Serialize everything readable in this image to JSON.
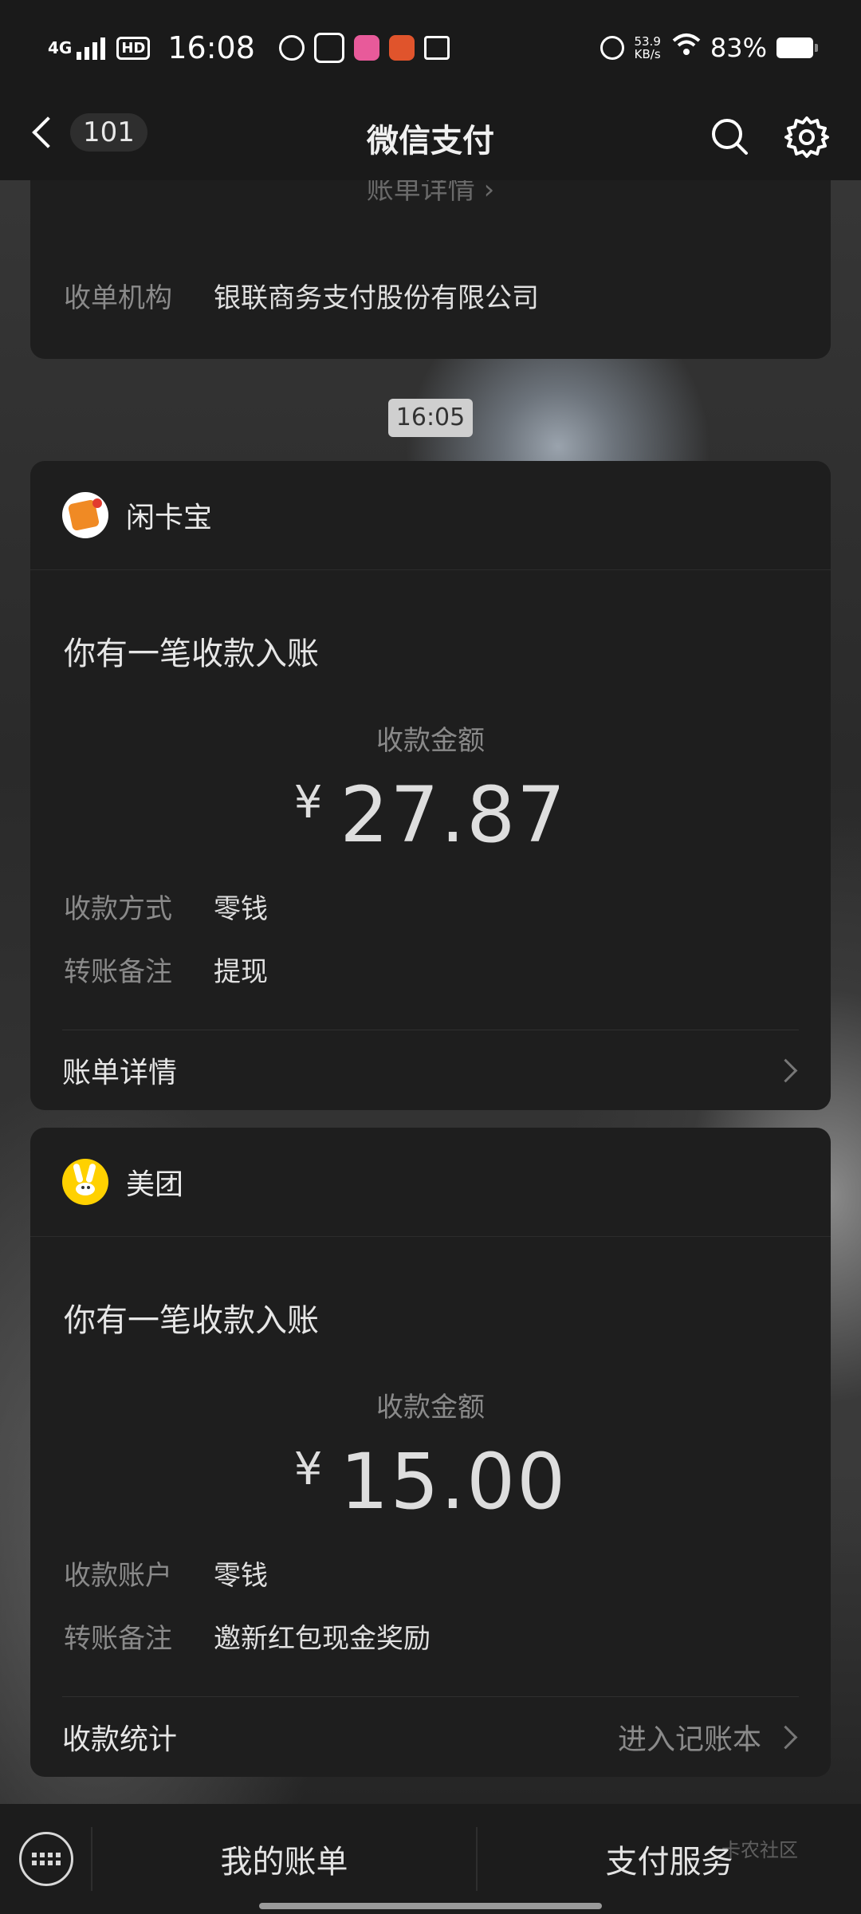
{
  "status_bar": {
    "network": "4G",
    "hd": "HD",
    "time": "16:08",
    "net_speed_value": "53.9",
    "net_speed_unit": "KB/s",
    "battery": "83%"
  },
  "nav": {
    "unread_count": "101",
    "title": "微信支付"
  },
  "previous_card": {
    "detail_link": "账单详情",
    "row_label": "收单机构",
    "row_value": "银联商务支付股份有限公司"
  },
  "time_divider": "16:05",
  "cards": [
    {
      "sender": "闲卡宝",
      "title": "你有一笔收款入账",
      "amount_label": "收款金额",
      "currency": "¥",
      "amount": "27.87",
      "rows": [
        {
          "label": "收款方式",
          "value": "零钱"
        },
        {
          "label": "转账备注",
          "value": "提现"
        }
      ],
      "footer_left": "账单详情",
      "footer_right": ""
    },
    {
      "sender": "美团",
      "title": "你有一笔收款入账",
      "amount_label": "收款金额",
      "currency": "¥",
      "amount": "15.00",
      "rows": [
        {
          "label": "收款账户",
          "value": "零钱"
        },
        {
          "label": "转账备注",
          "value": "邀新红包现金奖励"
        }
      ],
      "footer_left": "收款统计",
      "footer_right": "进入记账本"
    }
  ],
  "bottom_menu": {
    "item1": "我的账单",
    "item2": "支付服务"
  },
  "watermark": "卡农社区",
  "colors": {
    "card_bg": "#1e1e1e",
    "bar_bg": "#1a1a1a",
    "xiankabao_logo": "#f08a24",
    "meituan_logo": "#ffd100"
  },
  "icons": [
    "back-icon",
    "search-icon",
    "settings-icon",
    "keyboard-icon",
    "chevron-right-icon"
  ]
}
